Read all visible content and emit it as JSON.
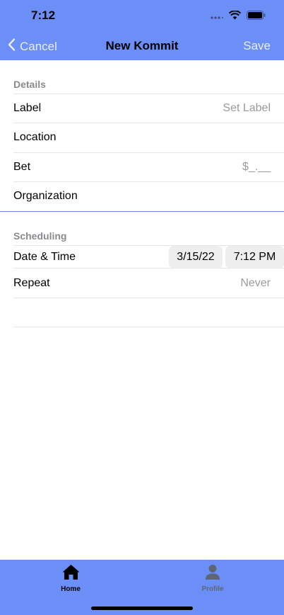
{
  "status": {
    "time": "7:12"
  },
  "nav": {
    "cancel_label": "Cancel",
    "title": "New Kommit",
    "save_label": "Save"
  },
  "details": {
    "header": "Details",
    "rows": [
      {
        "label": "Label",
        "value": "Set Label"
      },
      {
        "label": "Location",
        "value": ""
      },
      {
        "label": "Bet",
        "value": "$_.__"
      },
      {
        "label": "Organization",
        "value": ""
      }
    ]
  },
  "scheduling": {
    "header": "Scheduling",
    "date_time_label": "Date & Time",
    "date": "3/15/22",
    "time": "7:12 PM",
    "repeat_label": "Repeat",
    "repeat_value": "Never"
  },
  "tabs": [
    {
      "label": "Home",
      "icon": "house-icon",
      "active": true
    },
    {
      "label": "Profile",
      "icon": "person-icon",
      "active": false
    }
  ],
  "colors": {
    "accent": "#6b8ff7",
    "inactive_tab": "#5e6675"
  }
}
